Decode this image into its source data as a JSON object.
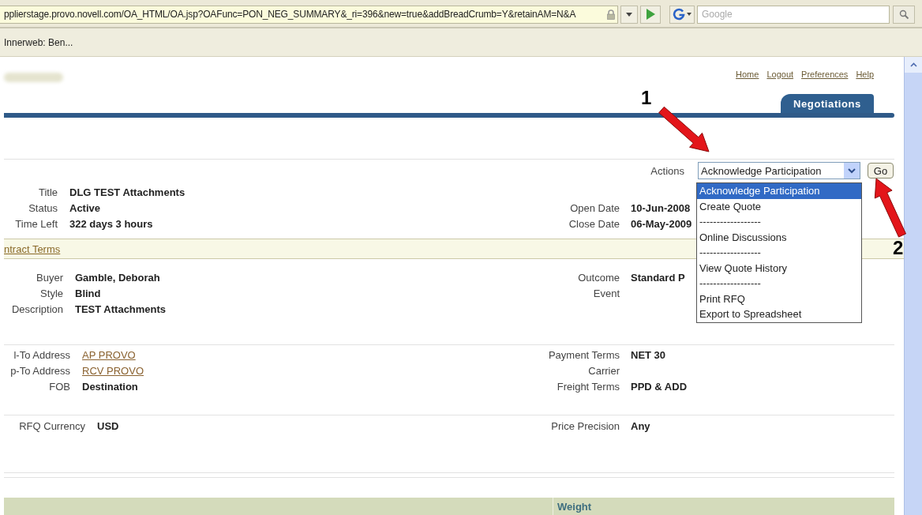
{
  "browser": {
    "address": "pplierstage.provo.novell.com/OA_HTML/OA.jsp?OAFunc=PON_NEG_SUMMARY&_ri=396&new=true&addBreadCrumb=Y&retainAM=N&A",
    "search_placeholder": "Google"
  },
  "bookmarks": [
    "Innerweb: Ben..."
  ],
  "global_links": [
    "Home",
    "Logout",
    "Preferences",
    "Help"
  ],
  "tabs": [
    {
      "label": "Negotiations",
      "selected": true
    }
  ],
  "actions": {
    "label": "Actions",
    "value": "Acknowledge Participation",
    "go": "Go",
    "options": [
      {
        "label": "Acknowledge Participation",
        "selected": true
      },
      {
        "label": "Create Quote",
        "selected": false
      },
      {
        "label": "------------------",
        "selected": false
      },
      {
        "label": "Online Discussions",
        "selected": false
      },
      {
        "label": "------------------",
        "selected": false
      },
      {
        "label": "View Quote History",
        "selected": false
      },
      {
        "label": "------------------",
        "selected": false
      },
      {
        "label": "Print RFQ",
        "selected": false
      },
      {
        "label": "Export to Spreadsheet",
        "selected": false
      }
    ]
  },
  "contract_terms_link": "ntract Terms",
  "sections": [
    {
      "left": [
        {
          "label": "Title",
          "value": "DLG TEST Attachments",
          "kind": "text"
        },
        {
          "label": "Status",
          "value": "Active",
          "kind": "text"
        },
        {
          "label": "Time Left",
          "value": "322 days 3 hours",
          "kind": "text"
        }
      ],
      "right": [
        {
          "label": "Open Date",
          "value": "10-Jun-2008",
          "kind": "text"
        },
        {
          "label": "Close Date",
          "value": "06-May-2009",
          "kind": "text"
        }
      ]
    },
    {
      "left": [
        {
          "label": "Buyer",
          "value": "Gamble, Deborah",
          "kind": "text"
        },
        {
          "label": "Style",
          "value": "Blind",
          "kind": "text"
        },
        {
          "label": "Description",
          "value": "TEST Attachments",
          "kind": "text"
        }
      ],
      "right": [
        {
          "label": "Outcome",
          "value": "Standard P",
          "kind": "text"
        },
        {
          "label": "Event"
        }
      ]
    },
    {
      "left": [
        {
          "label": "l-To Address",
          "value": "AP PROVO",
          "kind": "link"
        },
        {
          "label": "p-To Address",
          "value": "RCV PROVO",
          "kind": "link"
        },
        {
          "label": "FOB",
          "value": "Destination",
          "kind": "text"
        }
      ],
      "right": [
        {
          "label": "Payment Terms",
          "value": "NET 30",
          "kind": "text"
        },
        {
          "label": "Carrier"
        },
        {
          "label": "Freight Terms",
          "value": "PPD & ADD",
          "kind": "text"
        }
      ]
    },
    {
      "left": [
        {
          "label": "RFQ Currency",
          "value": "USD",
          "kind": "text"
        }
      ],
      "right": [
        {
          "label": "Price Precision",
          "value": "Any",
          "kind": "text"
        }
      ]
    }
  ],
  "table": {
    "columns": [
      "Weight"
    ]
  },
  "annotations": [
    {
      "label": "1"
    },
    {
      "label": "2"
    }
  ]
}
